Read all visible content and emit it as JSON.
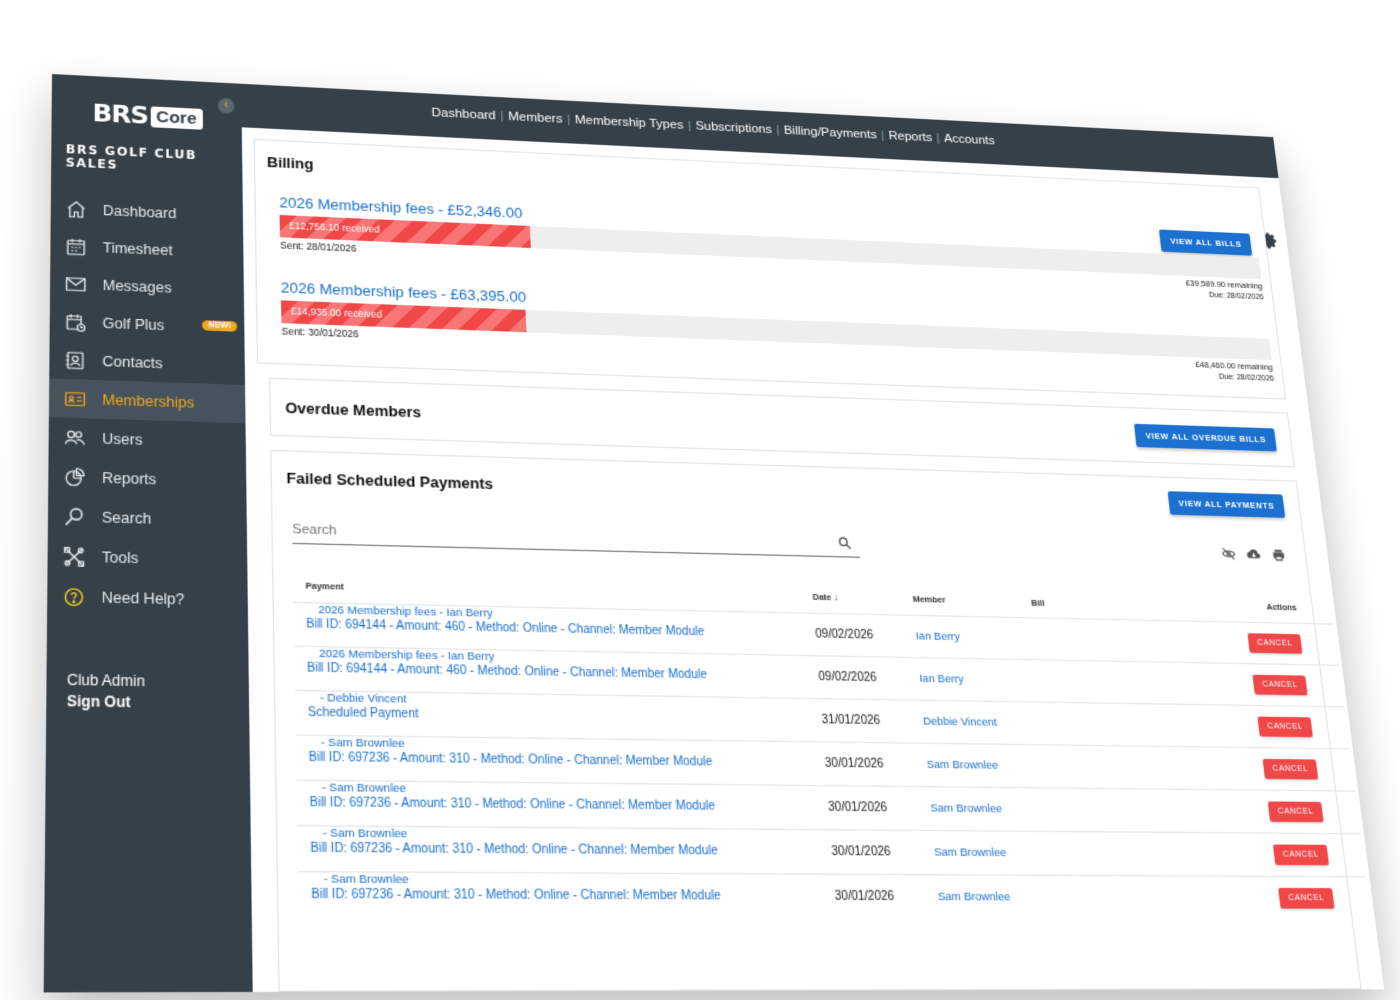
{
  "brand": {
    "logo_text": "BRS",
    "logo_badge": "Core",
    "club_name": "BRS GOLF CLUB SALES"
  },
  "sidebar": {
    "items": [
      {
        "label": "Dashboard",
        "icon": "home-icon"
      },
      {
        "label": "Timesheet",
        "icon": "calendar-icon"
      },
      {
        "label": "Messages",
        "icon": "envelope-icon"
      },
      {
        "label": "Golf Plus",
        "icon": "calendar-clock-icon",
        "badge": "NEW!"
      },
      {
        "label": "Contacts",
        "icon": "contacts-icon"
      },
      {
        "label": "Memberships",
        "icon": "membership-card-icon",
        "active": true
      },
      {
        "label": "Users",
        "icon": "users-icon"
      },
      {
        "label": "Reports",
        "icon": "pie-chart-icon"
      },
      {
        "label": "Search",
        "icon": "search-icon"
      },
      {
        "label": "Tools",
        "icon": "tools-icon"
      },
      {
        "label": "Need Help?",
        "icon": "help-icon"
      }
    ],
    "user_label": "Club Admin",
    "sign_out": "Sign Out"
  },
  "topnav": [
    "Dashboard",
    "Members",
    "Membership Types",
    "Subscriptions",
    "Billing/Payments",
    "Reports",
    "Accounts"
  ],
  "billing": {
    "title": "Billing",
    "view_all_label": "VIEW ALL BILLS",
    "bills": [
      {
        "title": "2026 Membership fees - £52,346.00",
        "received": "£12,756.10 received",
        "progress": 0.244,
        "sent": "Sent: 28/01/2026",
        "remaining": "£39,589.90 remaining",
        "due": "Due: 28/02/2026"
      },
      {
        "title": "2026 Membership fees - £63,395.00",
        "received": "£14,935.00 received",
        "progress": 0.236,
        "sent": "Sent: 30/01/2026",
        "remaining": "£48,460.00 remaining",
        "due": "Due: 28/02/2026"
      }
    ]
  },
  "overdue": {
    "title": "Overdue Members",
    "button": "VIEW ALL OVERDUE BILLS"
  },
  "failed": {
    "title": "Failed Scheduled Payments",
    "button": "VIEW ALL PAYMENTS",
    "search_placeholder": "Search",
    "columns": {
      "payment": "Payment",
      "date": "Date",
      "member": "Member",
      "bill": "Bill",
      "actions": "Actions"
    },
    "cancel_label": "CANCEL",
    "rows": [
      {
        "payment": "Bill ID: 694144 - Amount: 460 - Method: Online - Channel: Member Module",
        "date": "09/02/2026",
        "member": "Ian Berry",
        "bill": "2026 Membership fees - Ian Berry"
      },
      {
        "payment": "Bill ID: 694144 - Amount: 460 - Method: Online - Channel: Member Module",
        "date": "09/02/2026",
        "member": "Ian Berry",
        "bill": "2026 Membership fees - Ian Berry"
      },
      {
        "payment": "Scheduled Payment",
        "date": "31/01/2026",
        "member": "Debbie Vincent",
        "bill": "- Debbie Vincent"
      },
      {
        "payment": "Bill ID: 697236 - Amount: 310 - Method: Online - Channel: Member Module",
        "date": "30/01/2026",
        "member": "Sam Brownlee",
        "bill": "- Sam Brownlee"
      },
      {
        "payment": "Bill ID: 697236 - Amount: 310 - Method: Online - Channel: Member Module",
        "date": "30/01/2026",
        "member": "Sam Brownlee",
        "bill": "- Sam Brownlee"
      },
      {
        "payment": "Bill ID: 697236 - Amount: 310 - Method: Online - Channel: Member Module",
        "date": "30/01/2026",
        "member": "Sam Brownlee",
        "bill": "- Sam Brownlee"
      },
      {
        "payment": "Bill ID: 697236 - Amount: 310 - Method: Online - Channel: Member Module",
        "date": "30/01/2026",
        "member": "Sam Brownlee",
        "bill": "- Sam Brownlee"
      }
    ]
  },
  "colors": {
    "sidebar": "#354049",
    "accent": "#f2a81e",
    "link": "#1c70d0",
    "danger": "#f04848"
  }
}
